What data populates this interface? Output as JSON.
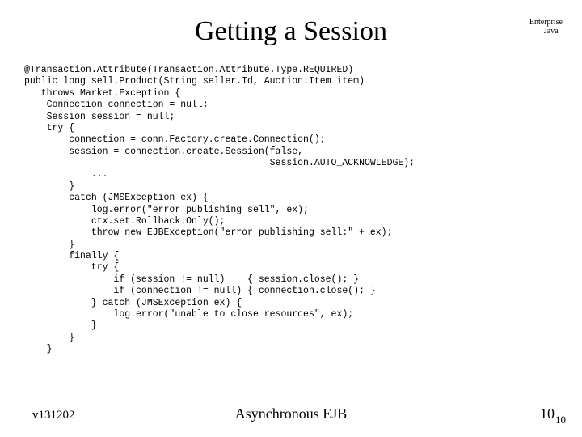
{
  "title": "Getting a Session",
  "corner": {
    "line1": "Enterprise",
    "line2": "Java"
  },
  "code": "@Transaction.Attribute(Transaction.Attribute.Type.REQUIRED)\npublic long sell.Product(String seller.Id, Auction.Item item)\n   throws Market.Exception {\n    Connection connection = null;\n    Session session = null;\n    try {\n        connection = conn.Factory.create.Connection();\n        session = connection.create.Session(false,\n                                            Session.AUTO_ACKNOWLEDGE);\n            ...\n        }\n        catch (JMSException ex) {\n            log.error(\"error publishing sell\", ex);\n            ctx.set.Rollback.Only();\n            throw new EJBException(\"error publishing sell:\" + ex);\n        }\n        finally {\n            try {\n                if (session != null)    { session.close(); }\n                if (connection != null) { connection.close(); }\n            } catch (JMSException ex) {\n                log.error(\"unable to close resources\", ex);\n            }\n        }\n    }",
  "footer": {
    "left": "v131202",
    "center": "Asynchronous EJB",
    "right": "10",
    "right_sub": "10"
  }
}
